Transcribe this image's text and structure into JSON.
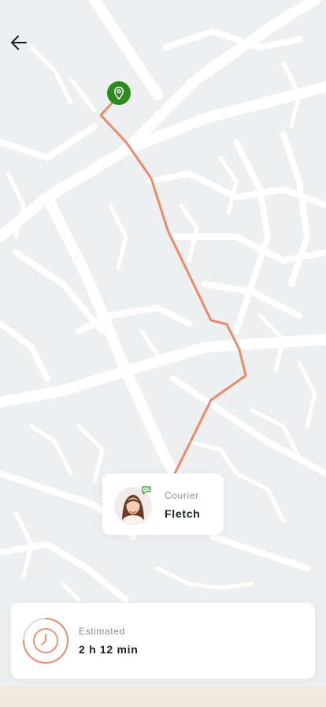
{
  "colors": {
    "map_background": "#eeeff1",
    "road": "#ffffff",
    "route": "#e58d6c",
    "pin": "#2d8a1f",
    "chat_badge": "#2d8a1f",
    "eta_ring_progress": "#e58d6c",
    "eta_ring_track": "#d9dadd"
  },
  "icons": {
    "back": "arrow-left-icon",
    "pin": "location-pin-icon",
    "chat": "chat-bubble-icon",
    "clock": "clock-icon"
  },
  "courier": {
    "role_label": "Courier",
    "name": "Fletch"
  },
  "eta": {
    "label": "Estimated",
    "value": "2 h 12 min",
    "progress": 0.75
  }
}
